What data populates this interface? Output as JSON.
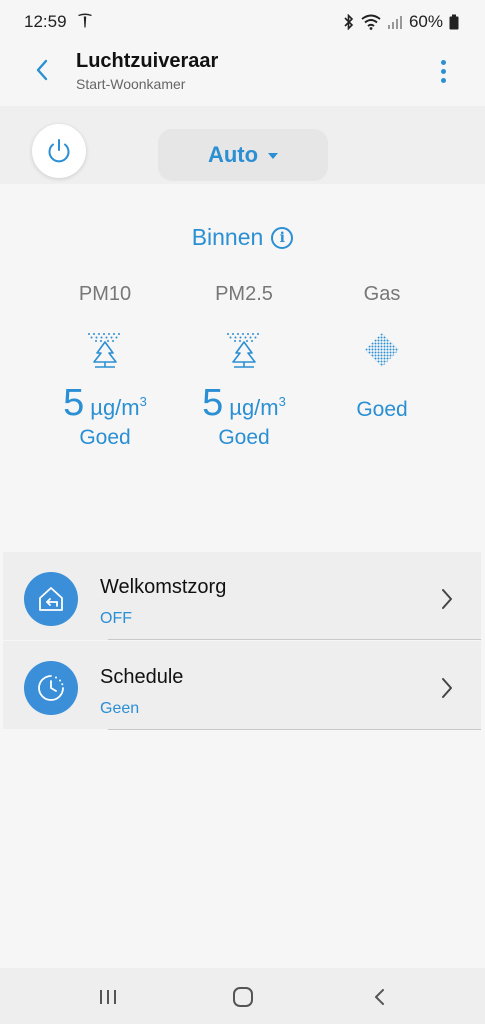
{
  "status_bar": {
    "time": "12:59",
    "battery": "60%"
  },
  "app_bar": {
    "title": "Luchtzuiveraar",
    "subtitle": "Start-Woonkamer"
  },
  "controls": {
    "mode": "Auto"
  },
  "indoor": {
    "title": "Binnen",
    "info_glyph": "i",
    "metrics": [
      {
        "label": "PM10",
        "value": "5",
        "unit": "µg/m",
        "unit_sup": "3",
        "status": "Goed",
        "icon": "tree-particles-icon"
      },
      {
        "label": "PM2.5",
        "value": "5",
        "unit": "µg/m",
        "unit_sup": "3",
        "status": "Goed",
        "icon": "tree-particles-icon"
      },
      {
        "label": "Gas",
        "status": "Goed",
        "icon": "gas-dots-icon"
      }
    ]
  },
  "list": [
    {
      "title": "Welkomstzorg",
      "subtitle": "OFF",
      "icon": "home-return-icon"
    },
    {
      "title": "Schedule",
      "subtitle": "Geen",
      "icon": "clock-icon"
    }
  ],
  "colors": {
    "accent": "#2b8fd4",
    "icon_bg": "#3a8fd8",
    "background": "#f6f6f6"
  }
}
